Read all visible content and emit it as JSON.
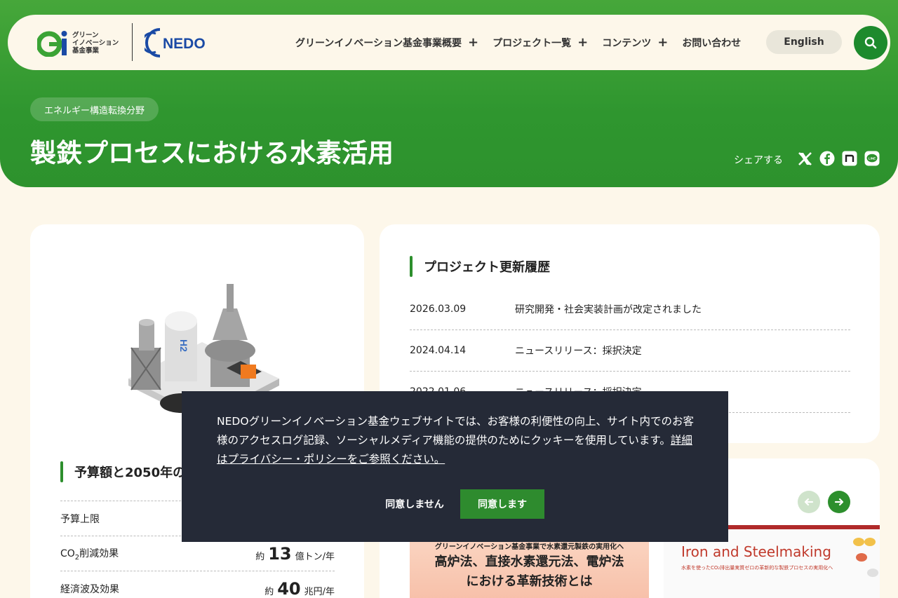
{
  "header": {
    "gi_logo_text": "グリーン\nイノベーション\n基金事業",
    "nedo_logo_text": "NEDO",
    "nav": [
      {
        "label": "グリーンイノベーション基金事業概要",
        "plus": "+"
      },
      {
        "label": "プロジェクト一覧",
        "plus": "+"
      },
      {
        "label": "コンテンツ",
        "plus": "+"
      },
      {
        "label": "お問い合わせ",
        "plus": ""
      }
    ],
    "language_button": "English",
    "search_icon": "search-icon"
  },
  "hero": {
    "field_badge": "エネルギー構造転換分野",
    "title": "製鉄プロセスにおける水素活用",
    "share_label": "シェアする",
    "share_icons": [
      "x-icon",
      "facebook-icon",
      "note-icon",
      "line-icon"
    ]
  },
  "budget": {
    "heading": "予算額と2050年の",
    "rows": [
      {
        "label": "予算上限",
        "prefix": "",
        "value": "",
        "unit": ""
      },
      {
        "label_main": "CO",
        "label_sub": "2",
        "label_rest": "削減効果",
        "prefix": "約",
        "value": "13",
        "unit": "億トン/年"
      },
      {
        "label": "経済波及効果",
        "prefix": "約",
        "value": "40",
        "unit": "兆円/年"
      }
    ]
  },
  "updates": {
    "heading": "プロジェクト更新履歴",
    "items": [
      {
        "date": "2026.03.09",
        "text": "研究開発・社会実装計画が改定されました"
      },
      {
        "date": "2024.04.14",
        "text": "ニュースリリース：採択決定"
      },
      {
        "date": "2022.01.06",
        "text": "ニュースリリース：採択決定"
      }
    ]
  },
  "carousel": {
    "thumb1_sub": "グリーンイノベーション基金事業で水素還元製鉄の実用化へ",
    "thumb1_main_1": "高炉法、直接水素還元法、電炉法",
    "thumb1_main_2": "における革新技術とは",
    "thumb2_title": "Iron and Steelmaking",
    "thumb2_sub": "水素を使ったCO₂排出量実質ゼロの革新的な製鉄プロセスの実用化へ",
    "prev_icon": "arrow-left-icon",
    "next_icon": "arrow-right-icon"
  },
  "cookie": {
    "text": "NEDOグリーンイノベーション基金ウェブサイトでは、お客様の利便性の向上、サイト内でのお客様のアクセスログ記録、ソーシャルメディア機能の提供のためにクッキーを使用しています。",
    "link": "詳細はプライバシー・ポリシーをご参照ください。",
    "decline": "同意しません",
    "accept": "同意します"
  },
  "colors": {
    "primary_green": "#2d922d",
    "button_green": "#2e8b2e",
    "background": "#fdf7ea",
    "cookie_bg": "#252a37"
  }
}
